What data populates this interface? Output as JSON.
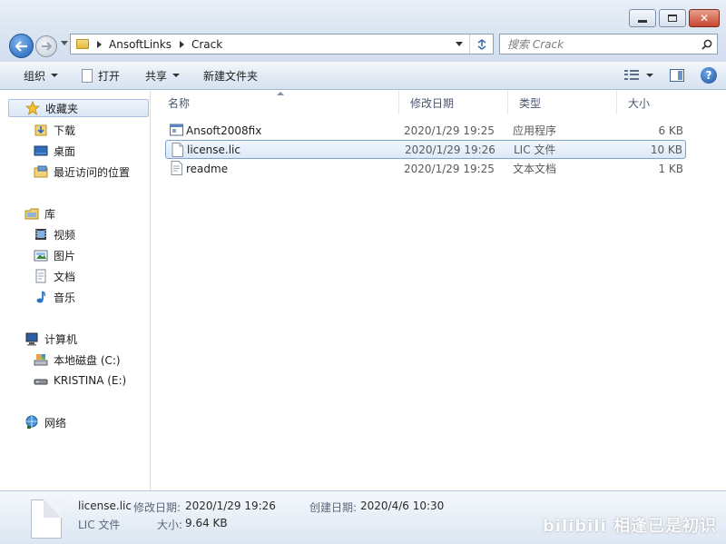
{
  "address": {
    "crumbs": [
      "AnsoftLinks",
      "Crack"
    ]
  },
  "search": {
    "placeholder": "搜索 Crack"
  },
  "toolbar": {
    "organize": "组织",
    "open": "打开",
    "share": "共享",
    "new_folder": "新建文件夹"
  },
  "nav": {
    "favorites": "收藏夹",
    "downloads": "下载",
    "desktop": "桌面",
    "recent": "最近访问的位置",
    "libraries": "库",
    "videos": "视频",
    "pictures": "图片",
    "documents": "文档",
    "music": "音乐",
    "computer": "计算机",
    "local_disk": "本地磁盘 (C:)",
    "drive_e": "KRISTINA (E:)",
    "network": "网络"
  },
  "columns": {
    "name": "名称",
    "date": "修改日期",
    "type": "类型",
    "size": "大小"
  },
  "files": [
    {
      "name": "Ansoft2008fix",
      "date": "2020/1/29 19:25",
      "type": "应用程序",
      "size": "6 KB",
      "icon": "application-icon"
    },
    {
      "name": "license.lic",
      "date": "2020/1/29 19:26",
      "type": "LIC 文件",
      "size": "10 KB",
      "icon": "blank-file-icon"
    },
    {
      "name": "readme",
      "date": "2020/1/29 19:25",
      "type": "文本文档",
      "size": "1 KB",
      "icon": "text-file-icon"
    }
  ],
  "details": {
    "filename": "license.lic",
    "filetype": "LIC 文件",
    "modified_label": "修改日期:",
    "modified_value": "2020/1/29 19:26",
    "created_label": "创建日期:",
    "created_value": "2020/4/6 10:30",
    "size_label": "大小:",
    "size_value": "9.64 KB"
  },
  "watermark": "bilibili 相逢已是初识",
  "colors": {
    "selection_border": "#7da2ce",
    "toolbar_bg": "#dfe8f4",
    "accent_blue": "#1f5fb3"
  }
}
